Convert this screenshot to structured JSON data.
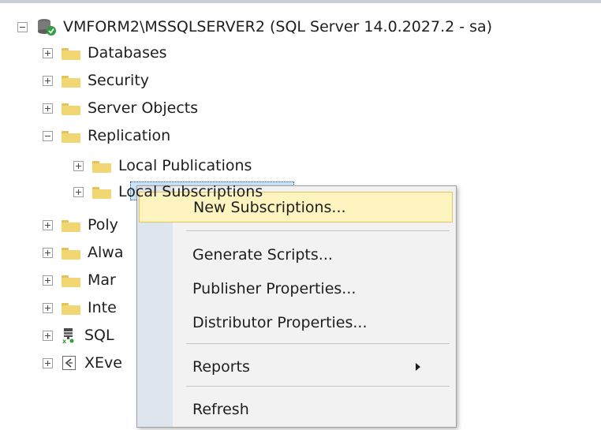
{
  "object_explorer": {
    "server_label": "VMFORM2\\MSSQLSERVER2 (SQL Server 14.0.2027.2 - sa)",
    "nodes": [
      {
        "label": "Databases"
      },
      {
        "label": "Security"
      },
      {
        "label": "Server Objects"
      },
      {
        "label": "Replication"
      },
      {
        "label": "Local Publications"
      },
      {
        "label": "Local Subscriptions"
      },
      {
        "label": "Poly"
      },
      {
        "label": "Alwa"
      },
      {
        "label": "Mar"
      },
      {
        "label": "Inte"
      },
      {
        "label": "SQL"
      },
      {
        "label": "XEve"
      }
    ]
  },
  "context_menu": {
    "items": [
      {
        "label": "New Subscriptions..."
      },
      {
        "label": "Generate Scripts..."
      },
      {
        "label": "Publisher Properties..."
      },
      {
        "label": "Distributor Properties..."
      },
      {
        "label": "Reports"
      },
      {
        "label": "Refresh"
      }
    ]
  },
  "colors": {
    "menu_hover": "#fdf4c0",
    "folder": "#f3d674",
    "selection": "#cce4f7"
  }
}
